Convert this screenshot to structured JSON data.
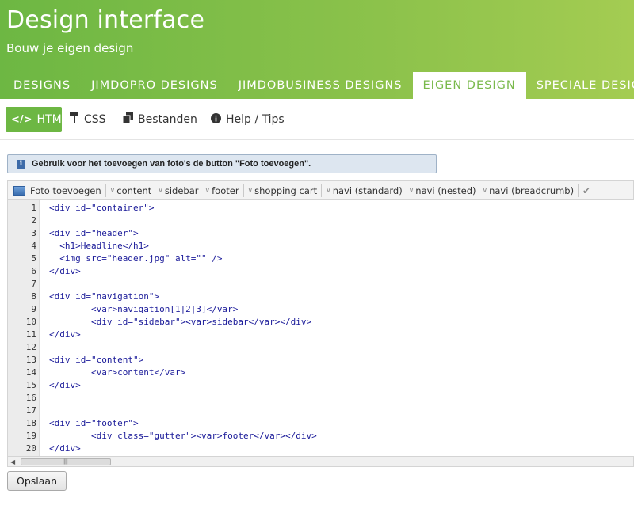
{
  "header": {
    "title": "Design interface",
    "subtitle": "Bouw je eigen design"
  },
  "tabs": [
    {
      "label": "DESIGNS",
      "active": false
    },
    {
      "label": "JIMDOPRO DESIGNS",
      "active": false
    },
    {
      "label": "JIMDOBUSINESS DESIGNS",
      "active": false
    },
    {
      "label": "EIGEN DESIGN",
      "active": true
    },
    {
      "label": "SPECIALE DESIGNS",
      "active": false
    }
  ],
  "subnav": [
    {
      "label": "HTML",
      "icon": "code-icon",
      "active": true
    },
    {
      "label": "CSS",
      "icon": "paint-roller-icon",
      "active": false
    },
    {
      "label": "Bestanden",
      "icon": "files-icon",
      "active": false
    },
    {
      "label": "Help / Tips",
      "icon": "info-icon",
      "active": false
    }
  ],
  "info_bar": {
    "text": "Gebruik voor het toevoegen van foto's de button \"Foto toevoegen\"."
  },
  "toolbar": {
    "photo_button": "Foto toevoegen",
    "items": [
      "content",
      "sidebar",
      "footer",
      "shopping cart",
      "navi (standard)",
      "navi (nested)",
      "navi (breadcrumb)"
    ]
  },
  "editor": {
    "lines": [
      "<div id=\"container\">",
      "",
      "<div id=\"header\">",
      "  <h1>Headline</h1>",
      "  <img src=\"header.jpg\" alt=\"\" />",
      "</div>",
      "",
      "<div id=\"navigation\">",
      "        <var>navigation[1|2|3]</var>",
      "        <div id=\"sidebar\"><var>sidebar</var></div>",
      "</div>",
      "",
      "<div id=\"content\">",
      "        <var>content</var>",
      "</div>",
      "",
      "",
      "<div id=\"footer\">",
      "        <div class=\"gutter\"><var>footer</var></div>",
      "</div>"
    ]
  },
  "save_button": "Opslaan",
  "colors": {
    "brand_green": "#6db743",
    "active_tab_text": "#79b94b",
    "code_text": "#1a1a99"
  }
}
